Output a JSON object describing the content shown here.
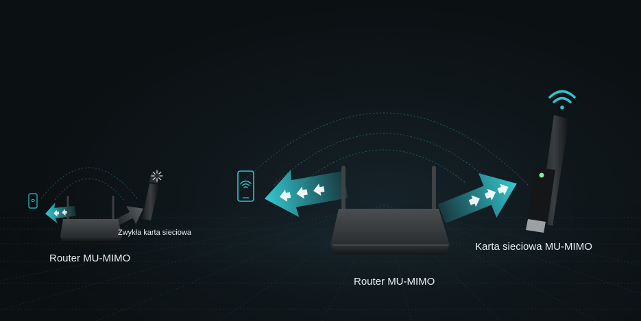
{
  "scene": {
    "background_color": "#0f1416",
    "accent_cyan": "#2ec4cf",
    "arrow_outgoing": "#35c9d2",
    "arrow_idle": "#5a6064"
  },
  "labels": {
    "left_router": "Router MU-MIMO",
    "left_card": "Zwykła karta sieciowa",
    "center_router": "Router MU-MIMO",
    "right_card": "Karta sieciowa MU-MIMO"
  },
  "icons": {
    "left_phone": "phone-wifi-icon",
    "center_phone": "phone-wifi-icon",
    "usb_wifi_signal": "wifi-signal-icon",
    "loading_spinner": "loading-spinner-icon"
  }
}
